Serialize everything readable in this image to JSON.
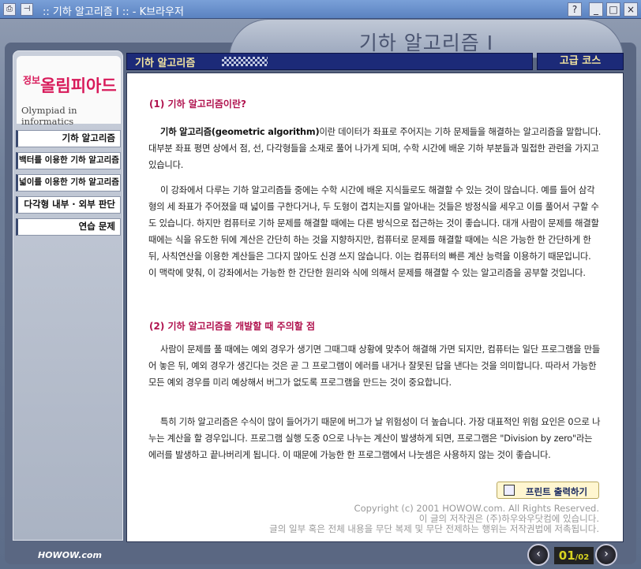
{
  "window": {
    "title": ":: 기하 알고리즘 I :: - K브라우저",
    "help_label": "?",
    "min_label": "_",
    "max_label": "□",
    "close_label": "×"
  },
  "page_title": "기하 알고리즘 I",
  "logo": {
    "ko_small": "정보",
    "ko": "올림피아드",
    "en": "Olympiad in informatics"
  },
  "sidebar": {
    "items": [
      {
        "label": "기하 알고리즘"
      },
      {
        "label": "백터를 이용한 기하 알고리즘"
      },
      {
        "label": "넓이를 이용한 기하 알고리즘"
      },
      {
        "label": "다각형 내부 · 외부 판단"
      },
      {
        "label": "연습 문제"
      }
    ]
  },
  "header": {
    "section": "기하 알고리즘",
    "level": "고급 코스"
  },
  "content": {
    "heading1": "(1) 기하 알고리즘이란?",
    "p1_bold": "기하 알고리즘(geometric algorithm)",
    "p1_rest": "이란 데이터가 좌표로 주어지는 기하 문제들을 해결하는 알고리즘을 말합니다. 대부분 좌표 평면 상에서 점, 선, 다각형들을 소재로 풀어 나가게 되며, 수학 시간에 배운 기하 부분들과 밀접한 관련을 가지고 있습니다.",
    "p2": "이 강좌에서 다루는 기하 알고리즘들 중에는 수학 시간에 배운 지식들로도 해결할 수 있는 것이 많습니다. 예를 들어 삼각형의 세 좌표가 주어졌을 때 넓이를 구한다거나, 두 도형이 겹치는지를 알아내는 것들은 방정식을 세우고 이를 풀어서 구할 수도 있습니다. 하지만 컴퓨터로 기하 문제를 해결할 때에는 다른 방식으로 접근하는 것이 좋습니다. 대개 사람이 문제를 해결할 때에는 식을 유도한 뒤에 계산은 간단히 하는 것을 지향하지만, 컴퓨터로 문제를 해결할 때에는 식은 가능한 한 간단하게 한 뒤, 사칙연산을 이용한 계산들은 그다지 많아도 신경 쓰지 않습니다. 이는 컴퓨터의 빠른 계산 능력을 이용하기 때문입니다. 이 맥락에 맞춰, 이 강좌에서는 가능한 한 간단한 원리와 식에 의해서 문제를 해결할 수 있는 알고리즘을 공부할 것입니다.",
    "heading2": "(2) 기하 알고리즘을 개발할 때 주의할 점",
    "p3": "사람이 문제를 풀 때에는 예외 경우가 생기면 그때그때 상황에 맞추어 해결해 가면 되지만, 컴퓨터는 일단 프로그램을 만들어 놓은 뒤, 예외 경우가 생긴다는 것은 곧 그 프로그램이 에러를 내거나 잘못된 답을 낸다는 것을 의미합니다. 따라서 가능한 모든 예외 경우를 미리 예상해서 버그가 없도록 프로그램을 만드는 것이 중요합니다.",
    "p4": "특히 기하 알고리즘은 수식이 많이 들어가기 때문에 버그가 날 위험성이 더 높습니다. 가장 대표적인 위험 요인은 0으로 나누는 계산을 할 경우입니다. 프로그램 실행 도중 0으로 나누는 계산이 발생하게 되면, 프로그램은 \"Division by zero\"라는 에러를 발생하고 끝나버리게 됩니다. 이 때문에 가능한 한 프로그램에서 나눗셈은 사용하지 않는 것이 좋습니다.",
    "print_label": "프린트 출력하기",
    "copy1": "Copyright (c) 2001 HOWOW.com. All Rights Reserved.",
    "copy2": "이 글의 저작권은 (주)하우와우닷컴에 있습니다.",
    "copy3": "글의 일부 혹은 전체 내용을 무단 복제 및 무단 전제하는 행위는 저작권법에 저촉됩니다."
  },
  "footer": {
    "brand": "HOWOW.com",
    "page_current": "01",
    "page_sep": "/",
    "page_total": "02",
    "prev": "‹",
    "next": "›"
  }
}
